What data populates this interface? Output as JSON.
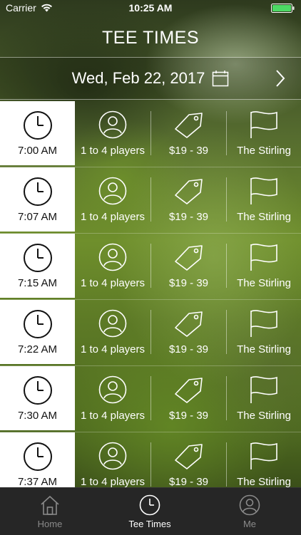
{
  "status_bar": {
    "carrier": "Carrier",
    "time": "10:25 AM"
  },
  "header": {
    "title": "TEE TIMES"
  },
  "date_bar": {
    "date": "Wed, Feb 22, 2017"
  },
  "tee_times": [
    {
      "time": "7:00 AM",
      "players": "1 to 4 players",
      "price": "$19 - 39",
      "course": "The Stirling"
    },
    {
      "time": "7:07 AM",
      "players": "1 to 4 players",
      "price": "$19 - 39",
      "course": "The Stirling"
    },
    {
      "time": "7:15 AM",
      "players": "1 to 4 players",
      "price": "$19 - 39",
      "course": "The Stirling"
    },
    {
      "time": "7:22 AM",
      "players": "1 to 4 players",
      "price": "$19 - 39",
      "course": "The Stirling"
    },
    {
      "time": "7:30 AM",
      "players": "1 to 4 players",
      "price": "$19 - 39",
      "course": "The Stirling"
    },
    {
      "time": "7:37 AM",
      "players": "1 to 4 players",
      "price": "$19 - 39",
      "course": "The Stirling"
    }
  ],
  "tab_bar": {
    "tabs": [
      {
        "label": "Home",
        "icon": "house-icon"
      },
      {
        "label": "Tee Times",
        "icon": "clock-icon"
      },
      {
        "label": "Me",
        "icon": "person-icon"
      }
    ],
    "active": "Tee Times"
  },
  "colors": {
    "battery": "#4cd964",
    "tab_bar_bg": "#262626",
    "inactive_tab": "#8a8a8a"
  }
}
